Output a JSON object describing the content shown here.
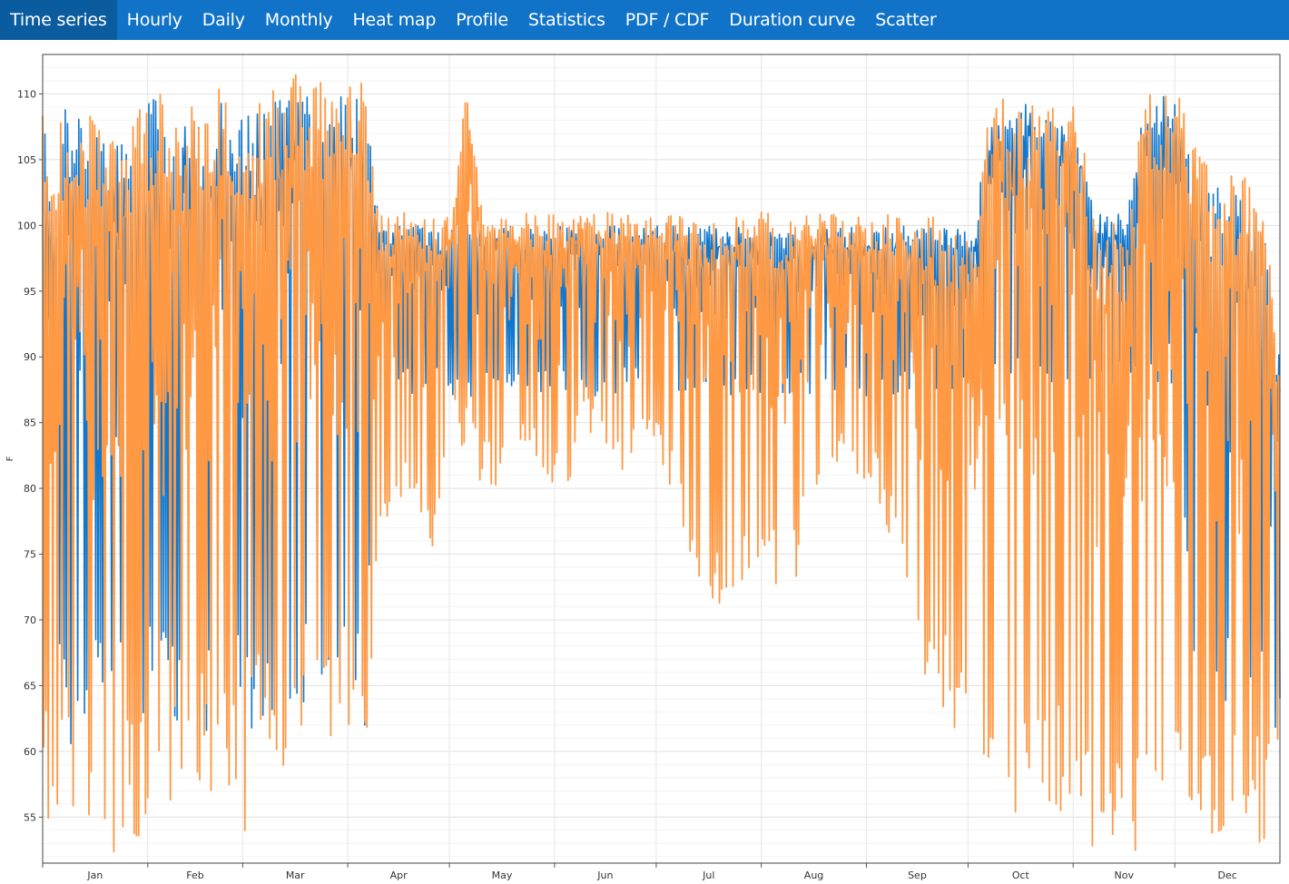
{
  "tabs": [
    {
      "label": "Time series",
      "active": true
    },
    {
      "label": "Hourly",
      "active": false
    },
    {
      "label": "Daily",
      "active": false
    },
    {
      "label": "Monthly",
      "active": false
    },
    {
      "label": "Heat map",
      "active": false
    },
    {
      "label": "Profile",
      "active": false
    },
    {
      "label": "Statistics",
      "active": false
    },
    {
      "label": "PDF / CDF",
      "active": false
    },
    {
      "label": "Duration curve",
      "active": false
    },
    {
      "label": "Scatter",
      "active": false
    }
  ],
  "chart_data": {
    "type": "line",
    "title": "",
    "xlabel": "",
    "ylabel": "F",
    "ylim": [
      51.5,
      113
    ],
    "yticks": [
      55,
      60,
      65,
      70,
      75,
      80,
      85,
      90,
      95,
      100,
      105,
      110
    ],
    "x_range_days": [
      0,
      365
    ],
    "month_labels": [
      "Jan",
      "Feb",
      "Mar",
      "Apr",
      "May",
      "Jun",
      "Jul",
      "Aug",
      "Sep",
      "Oct",
      "Nov",
      "Dec"
    ],
    "grid": true,
    "legend": "none",
    "colors": {
      "series_blue": "#1177cc",
      "series_orange": "#ff9944",
      "tab_bar": "#1173c7",
      "tab_active": "#0a5c9f"
    },
    "series": [
      {
        "color": "#1177cc",
        "x_days": [
          0,
          3,
          7,
          12,
          16,
          20,
          26,
          31,
          36,
          40,
          45,
          50,
          55,
          59,
          64,
          69,
          74,
          80,
          85,
          90,
          95,
          100,
          105,
          110,
          115,
          120,
          125,
          130,
          135,
          140,
          145,
          150,
          155,
          160,
          165,
          170,
          175,
          180,
          185,
          190,
          195,
          200,
          205,
          210,
          215,
          220,
          225,
          230,
          235,
          240,
          245,
          250,
          255,
          260,
          265,
          270,
          275,
          280,
          285,
          290,
          295,
          300,
          305,
          310,
          315,
          320,
          325,
          330,
          335,
          340,
          345,
          350,
          355,
          360,
          365
        ],
        "low": [
          61,
          61,
          60,
          61,
          61,
          62,
          61,
          61,
          61,
          61,
          61,
          61,
          61,
          62,
          61,
          61,
          62,
          62,
          62,
          62,
          62,
          88,
          88,
          87,
          87,
          87,
          87,
          87,
          87,
          87,
          87,
          87,
          87,
          87,
          87,
          87,
          87,
          87,
          87,
          87,
          87,
          87,
          87,
          87,
          87,
          87,
          87,
          87,
          87,
          87,
          87,
          87,
          87,
          87,
          87,
          87,
          87,
          87,
          87,
          87,
          87,
          87,
          87,
          88,
          88,
          88,
          88,
          88,
          88,
          62,
          62,
          62,
          62,
          61,
          61
        ],
        "high": [
          109,
          104,
          110,
          108,
          109,
          106,
          107,
          110,
          110,
          108,
          108,
          109,
          110,
          108,
          109,
          110,
          110,
          110,
          110,
          110,
          111,
          100,
          100,
          100,
          100,
          100,
          101,
          100,
          100,
          100,
          100,
          100,
          100,
          100,
          100,
          100,
          100,
          100,
          100,
          100,
          100,
          100,
          100,
          100,
          100,
          100,
          100,
          100,
          100,
          100,
          100,
          100,
          100,
          100,
          100,
          100,
          100,
          110,
          108,
          110,
          108,
          108,
          109,
          101,
          101,
          101,
          109,
          110,
          109,
          106,
          103,
          104,
          103,
          100,
          90
        ]
      },
      {
        "color": "#ff9944",
        "x_days": [
          0,
          3,
          7,
          12,
          16,
          20,
          26,
          31,
          36,
          40,
          45,
          50,
          55,
          59,
          64,
          69,
          74,
          80,
          85,
          90,
          95,
          100,
          105,
          110,
          115,
          120,
          125,
          130,
          135,
          140,
          145,
          150,
          155,
          160,
          165,
          170,
          175,
          180,
          185,
          190,
          195,
          200,
          205,
          210,
          215,
          220,
          225,
          230,
          235,
          240,
          245,
          250,
          255,
          260,
          265,
          270,
          275,
          280,
          285,
          290,
          295,
          300,
          305,
          310,
          315,
          320,
          325,
          330,
          335,
          340,
          345,
          350,
          355,
          360,
          365
        ],
        "low": [
          55,
          53,
          53,
          52,
          53,
          52,
          54,
          52,
          53,
          55,
          58,
          55,
          55,
          53,
          60,
          58,
          58,
          60,
          60,
          60,
          57,
          75,
          79,
          80,
          72,
          84,
          83,
          80,
          80,
          82,
          82,
          79,
          80,
          85,
          82,
          80,
          83,
          84,
          80,
          75,
          70,
          70,
          72,
          74,
          73,
          70,
          77,
          80,
          82,
          80,
          80,
          76,
          73,
          65,
          63,
          61,
          60,
          52,
          53,
          52,
          54,
          55,
          52,
          52,
          53,
          52,
          53,
          56,
          53,
          52,
          52,
          52,
          53,
          53,
          58
        ],
        "high": [
          110,
          108,
          110,
          109,
          110,
          107,
          108,
          111,
          110,
          109,
          109,
          110,
          111,
          109,
          110,
          111,
          112,
          111,
          111,
          111,
          112,
          101,
          101,
          101,
          101,
          101,
          110,
          101,
          101,
          101,
          101,
          101,
          101,
          101,
          101,
          101,
          101,
          101,
          101,
          101,
          101,
          101,
          101,
          101,
          101,
          101,
          101,
          101,
          101,
          101,
          101,
          101,
          101,
          101,
          101,
          101,
          101,
          110,
          110,
          110,
          109,
          109,
          110,
          101,
          101,
          101,
          110,
          111,
          110,
          107,
          104,
          105,
          104,
          101,
          91
        ]
      }
    ]
  }
}
